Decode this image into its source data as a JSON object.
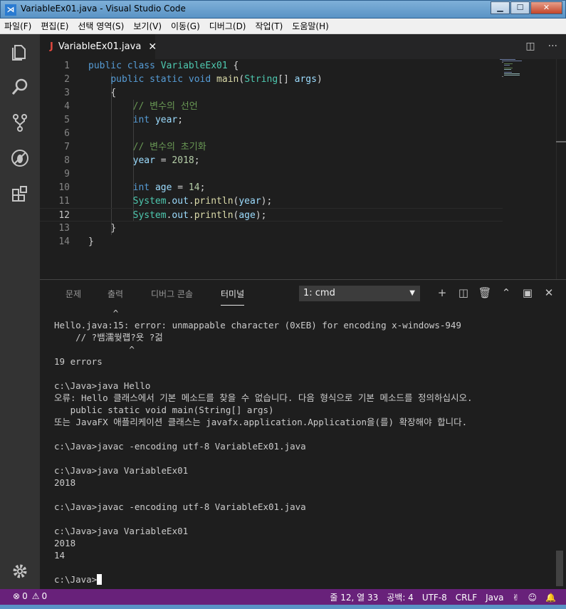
{
  "window": {
    "title": "VariableEx01.java - Visual Studio Code",
    "app_icon_glyph": "⋊"
  },
  "menu": [
    "파일(F)",
    "편집(E)",
    "선택 영역(S)",
    "보기(V)",
    "이동(G)",
    "디버그(D)",
    "작업(T)",
    "도움말(H)"
  ],
  "tab": {
    "label": "VariableEx01.java",
    "close": "✕",
    "icon": "J"
  },
  "editor": {
    "current_line": 12,
    "lines": [
      {
        "n": "1",
        "indent": 0,
        "tokens": [
          [
            "kw",
            "public"
          ],
          [
            "",
            "&sp;"
          ],
          [
            "kw",
            "class"
          ],
          [
            "",
            "&sp;"
          ],
          [
            "ty",
            "VariableEx01"
          ],
          [
            "",
            "&sp;{"
          ]
        ]
      },
      {
        "n": "2",
        "indent": 1,
        "tokens": [
          [
            "kw",
            "public"
          ],
          [
            "",
            "&sp;"
          ],
          [
            "kw",
            "static"
          ],
          [
            "",
            "&sp;"
          ],
          [
            "kw",
            "void"
          ],
          [
            "",
            "&sp;"
          ],
          [
            "fn",
            "main"
          ],
          [
            "",
            "("
          ],
          [
            "ty",
            "String"
          ],
          [
            "",
            "[]&sp;"
          ],
          [
            "var",
            "args"
          ],
          [
            "",
            ")"
          ]
        ]
      },
      {
        "n": "3",
        "indent": 1,
        "tokens": [
          [
            "",
            "{"
          ]
        ]
      },
      {
        "n": "4",
        "indent": 2,
        "tokens": [
          [
            "cm",
            "// 변수의 선언"
          ]
        ]
      },
      {
        "n": "5",
        "indent": 2,
        "tokens": [
          [
            "kw",
            "int"
          ],
          [
            "",
            "&sp;"
          ],
          [
            "var",
            "year"
          ],
          [
            "",
            ";"
          ]
        ]
      },
      {
        "n": "6",
        "indent": 0,
        "tokens": []
      },
      {
        "n": "7",
        "indent": 2,
        "tokens": [
          [
            "cm",
            "// 변수의 초기화"
          ]
        ]
      },
      {
        "n": "8",
        "indent": 2,
        "tokens": [
          [
            "var",
            "year"
          ],
          [
            "",
            "&sp;=&sp;"
          ],
          [
            "num",
            "2018"
          ],
          [
            "",
            ";"
          ]
        ]
      },
      {
        "n": "9",
        "indent": 0,
        "tokens": []
      },
      {
        "n": "10",
        "indent": 2,
        "tokens": [
          [
            "kw",
            "int"
          ],
          [
            "",
            "&sp;"
          ],
          [
            "var",
            "age"
          ],
          [
            "",
            "&sp;=&sp;"
          ],
          [
            "num",
            "14"
          ],
          [
            "",
            ";"
          ]
        ]
      },
      {
        "n": "11",
        "indent": 2,
        "tokens": [
          [
            "ty",
            "System"
          ],
          [
            "",
            "."
          ],
          [
            "var",
            "out"
          ],
          [
            "",
            "."
          ],
          [
            "fn",
            "println"
          ],
          [
            "",
            "("
          ],
          [
            "var",
            "year"
          ],
          [
            "",
            ");"
          ]
        ]
      },
      {
        "n": "12",
        "indent": 2,
        "tokens": [
          [
            "ty",
            "System"
          ],
          [
            "",
            "."
          ],
          [
            "var",
            "out"
          ],
          [
            "",
            "."
          ],
          [
            "fn",
            "println"
          ],
          [
            "",
            "("
          ],
          [
            "var",
            "age"
          ],
          [
            "",
            ");"
          ]
        ]
      },
      {
        "n": "13",
        "indent": 1,
        "tokens": [
          [
            "",
            "}"
          ]
        ]
      },
      {
        "n": "14",
        "indent": 0,
        "tokens": [
          [
            "",
            "}"
          ]
        ]
      }
    ]
  },
  "panel": {
    "tabs": [
      "문제",
      "출력",
      "디버그 콘솔",
      "터미널"
    ],
    "active_tab": 3,
    "terminal_select": "1: cmd",
    "actions": [
      "+",
      "◫",
      "🗑",
      "⌃",
      "▣",
      "✕"
    ],
    "terminal_lines": [
      "           ^",
      "Hello.java:15: error: unmappable character (0xEB) for encoding x-windows-949",
      "    // ?뱀濡쒖럡?욧 ?걺",
      "              ^",
      "19 errors",
      "",
      "c:\\Java>java Hello",
      "오류: Hello 클래스에서 기본 메소드를 찾을 수 없습니다. 다음 형식으로 기본 메소드를 정의하십시오.",
      "   public static void main(String[] args)",
      "또는 JavaFX 애플리케이션 클래스는 javafx.application.Application을(를) 확장해야 합니다.",
      "",
      "c:\\Java>javac -encoding utf-8 VariableEx01.java",
      "",
      "c:\\Java>java VariableEx01",
      "2018",
      "",
      "c:\\Java>javac -encoding utf-8 VariableEx01.java",
      "",
      "c:\\Java>java VariableEx01",
      "2018",
      "14",
      "",
      "c:\\Java>"
    ]
  },
  "status": {
    "errors": "0",
    "warnings": "0",
    "position": "줄 12, 열 33",
    "spaces": "공백: 4",
    "encoding": "UTF-8",
    "eol": "CRLF",
    "language": "Java"
  }
}
